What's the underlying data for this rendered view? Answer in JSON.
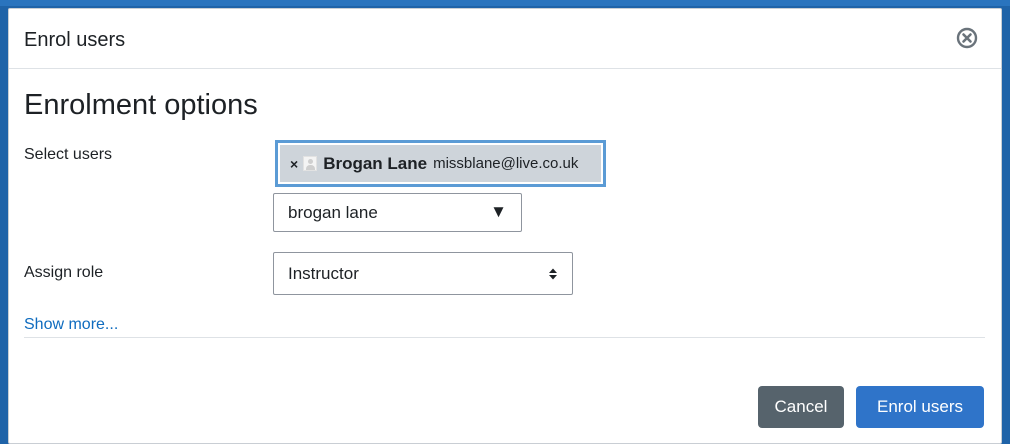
{
  "dialog": {
    "title": "Enrol users",
    "section_title": "Enrolment options"
  },
  "select_users": {
    "label": "Select users",
    "selected": [
      {
        "remove_symbol": "×",
        "name": "Brogan Lane",
        "email": "missblane@live.co.uk"
      }
    ],
    "search_value": "brogan lane",
    "dropdown_arrow": "▼"
  },
  "assign_role": {
    "label": "Assign role",
    "value": "Instructor"
  },
  "show_more": "Show more...",
  "buttons": {
    "cancel": "Cancel",
    "enrol": "Enrol users"
  },
  "colors": {
    "primary": "#2f74c9",
    "secondary": "#56636c",
    "link": "#0f6cbf",
    "selected_chip": "#ced4da",
    "focus_border": "#5b9bd5"
  },
  "icons": {
    "close": "close-circle-icon",
    "user": "user-picture-icon",
    "select_arrows": "up-down-arrows-icon"
  }
}
